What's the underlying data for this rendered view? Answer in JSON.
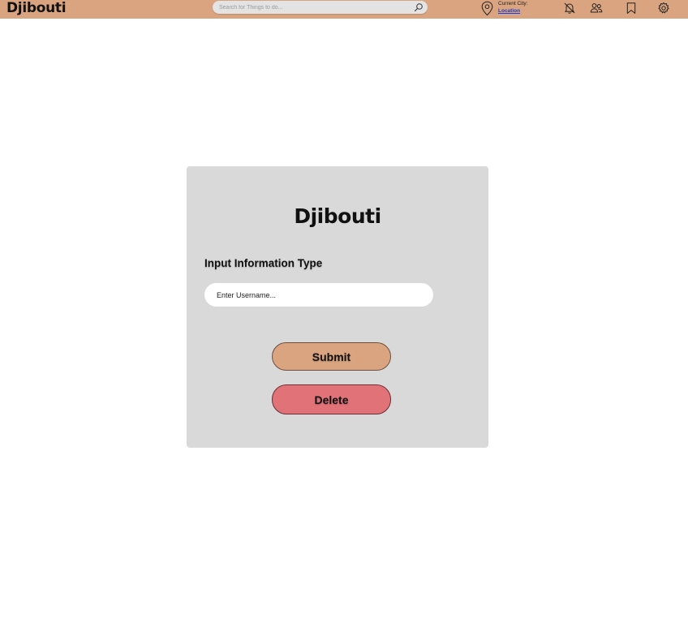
{
  "header": {
    "brand": "Djibouti",
    "search_placeholder": "Search for Things to do...",
    "city_label": "Current City:",
    "city_link": "Location",
    "icons": [
      "location-pin-icon",
      "notifications-off-icon",
      "friends-icon",
      "bookmark-icon",
      "settings-icon"
    ]
  },
  "card": {
    "logo": "Djibouti",
    "field_title": "Input Information Type",
    "username_placeholder": "Enter Username...",
    "submit_label": "Submit",
    "delete_label": "Delete"
  },
  "colors": {
    "topbar": "#d9a47f",
    "card_background": "#d9d9d9",
    "submit_button": "#d9a47f",
    "delete_button": "#e07278",
    "link": "#1a3fd6"
  }
}
